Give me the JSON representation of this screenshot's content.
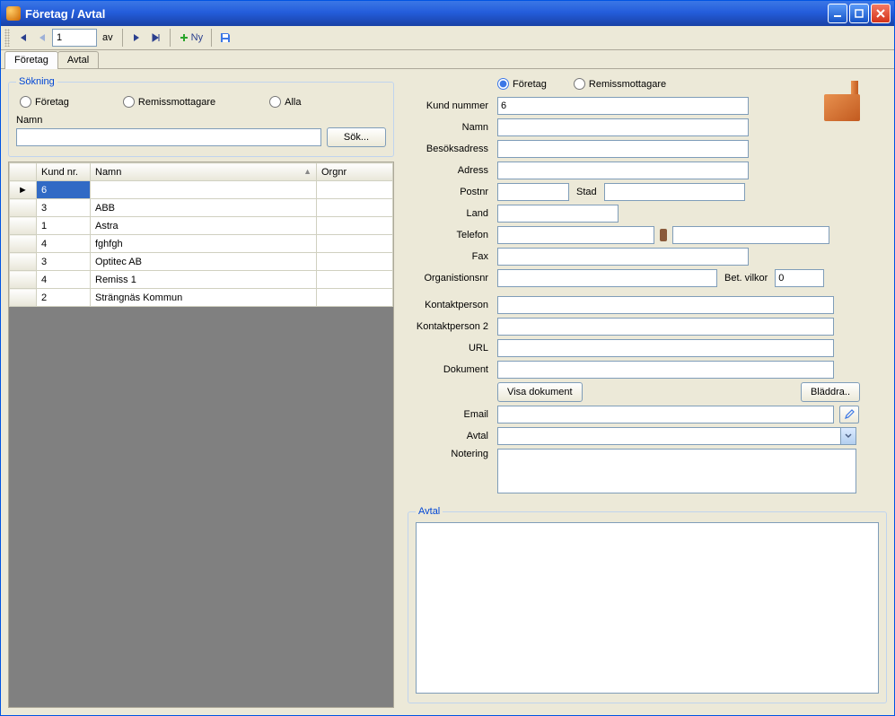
{
  "window": {
    "title": "Företag / Avtal"
  },
  "toolbar": {
    "page_value": "1",
    "of_label": "av",
    "new_label": "Ny"
  },
  "tabs": {
    "company": "Företag",
    "contract": "Avtal"
  },
  "search": {
    "legend": "Sökning",
    "opt_company": "Företag",
    "opt_recipient": "Remissmottagare",
    "opt_all": "Alla",
    "name_label": "Namn",
    "name_value": "",
    "search_btn": "Sök..."
  },
  "grid": {
    "columns": {
      "kundnr": "Kund nr.",
      "namn": "Namn",
      "orgnr": "Orgnr"
    },
    "rows": [
      {
        "kundnr": "6",
        "namn": "",
        "orgnr": ""
      },
      {
        "kundnr": "3",
        "namn": "ABB",
        "orgnr": ""
      },
      {
        "kundnr": "1",
        "namn": "Astra",
        "orgnr": ""
      },
      {
        "kundnr": "4",
        "namn": "fghfgh",
        "orgnr": ""
      },
      {
        "kundnr": "3",
        "namn": "Optitec AB",
        "orgnr": ""
      },
      {
        "kundnr": "4",
        "namn": "Remiss 1",
        "orgnr": ""
      },
      {
        "kundnr": "2",
        "namn": "Strängnäs Kommun",
        "orgnr": ""
      }
    ],
    "row_indicator": "►"
  },
  "form": {
    "opt_company": "Företag",
    "opt_recipient": "Remissmottagare",
    "labels": {
      "kundnummer": "Kund nummer",
      "namn": "Namn",
      "besoksadress": "Besöksadress",
      "adress": "Adress",
      "postnr": "Postnr",
      "stad": "Stad",
      "land": "Land",
      "telefon": "Telefon",
      "fax": "Fax",
      "orgnr": "Organistionsnr",
      "betvilkor": "Bet. vilkor",
      "kontakt1": "Kontaktperson",
      "kontakt2": "Kontaktperson 2",
      "url": "URL",
      "dokument": "Dokument",
      "visa_dokument": "Visa dokument",
      "bladdra": "Bläddra..",
      "email": "Email",
      "avtal": "Avtal",
      "notering": "Notering"
    },
    "values": {
      "kundnummer": "6",
      "namn": "",
      "besoksadress": "",
      "adress": "",
      "postnr": "",
      "stad": "",
      "land": "",
      "telefon": "",
      "mobil": "",
      "fax": "",
      "orgnr": "",
      "betvilkor": "0",
      "kontakt1": "",
      "kontakt2": "",
      "url": "",
      "dokument": "",
      "email": "",
      "avtal": "",
      "notering": ""
    }
  },
  "avtal_section": {
    "legend": "Avtal"
  }
}
